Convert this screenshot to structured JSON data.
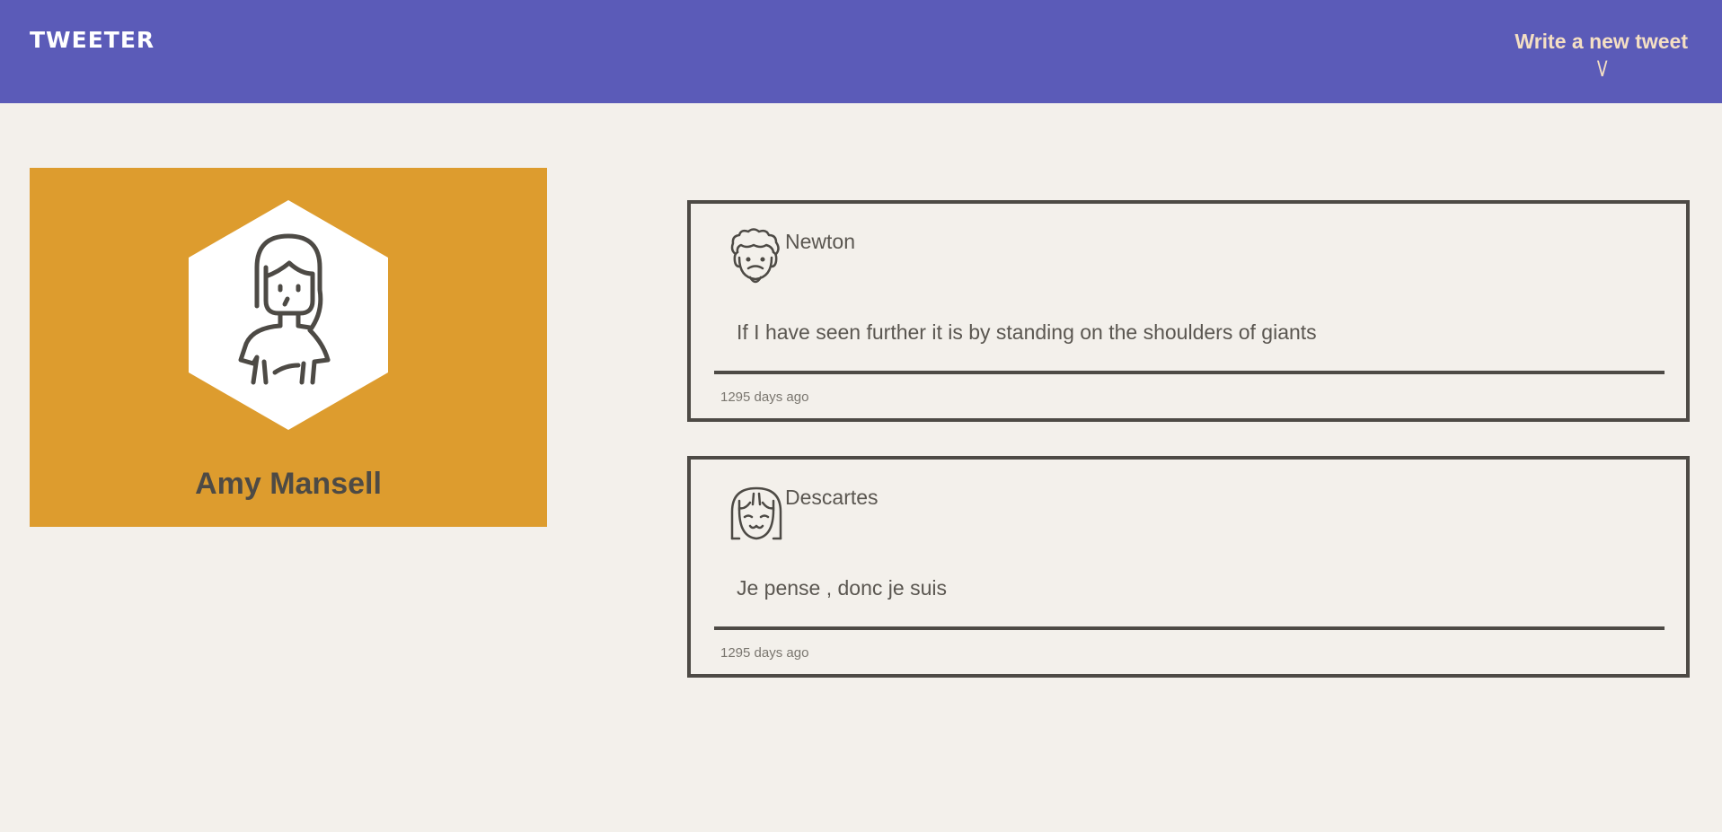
{
  "header": {
    "brand": "TWEETER",
    "compose_label": "Write a new tweet",
    "compose_arrow": "\\/"
  },
  "profile": {
    "name": "Amy Mansell",
    "avatar_icon": "woman-avatar-icon",
    "card_color": "#dd9c2e"
  },
  "tweets": [
    {
      "author": "Newton",
      "avatar_icon": "curly-hair-man-avatar-icon",
      "text": "If I have seen further it is by standing on the shoulders of giants",
      "time": "1295 days ago"
    },
    {
      "author": "Descartes",
      "avatar_icon": "bob-hair-avatar-icon",
      "text": "Je pense , donc je suis",
      "time": "1295 days ago"
    }
  ],
  "colors": {
    "nav": "#5b5bb8",
    "background": "#f3f0eb",
    "ink": "#4d4a45",
    "accent": "#f4dfc3"
  }
}
